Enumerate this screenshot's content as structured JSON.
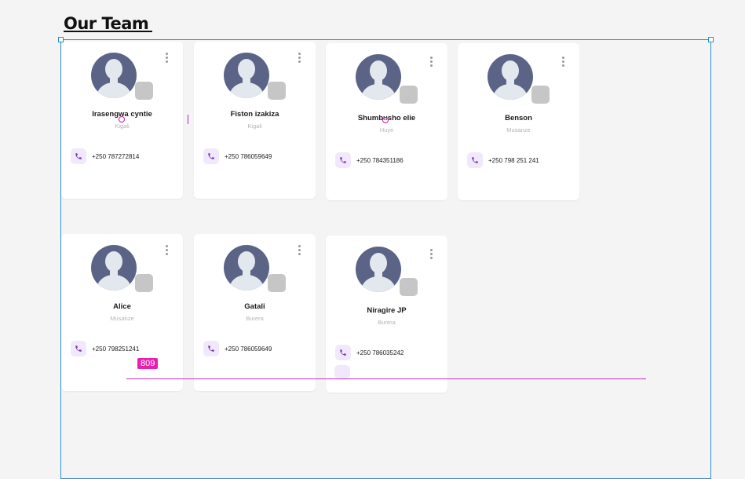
{
  "page": {
    "title": "Our Team"
  },
  "members": [
    {
      "name": "Irasengwa cyntie",
      "location": "Kigali",
      "phone": "+250 787272814"
    },
    {
      "name": "Fiston izakiza",
      "location": "Kigali",
      "phone": "+250 786059649"
    },
    {
      "name": "Shumbusho elie",
      "location": "Huye",
      "phone": "+250 784351186"
    },
    {
      "name": "Benson",
      "location": "Musanze",
      "phone": "+250 798 251 241"
    },
    {
      "name": "Alice",
      "location": "Musanze",
      "phone": "+250 798251241"
    },
    {
      "name": "Gatali",
      "location": "Burera",
      "phone": "+250 786059649"
    },
    {
      "name": "Niragire JP",
      "location": "Burera",
      "phone": "+250 786035242"
    }
  ],
  "overlay": {
    "measurement": "809"
  },
  "icons": {
    "avatar": "user-avatar-icon",
    "more": "more-vertical-icon",
    "phone": "phone-icon"
  },
  "colors": {
    "accent": "#7a2fbf",
    "avatar_bg": "#5b6486",
    "selection": "#2a8fd8",
    "guide": "#e81fb0"
  }
}
